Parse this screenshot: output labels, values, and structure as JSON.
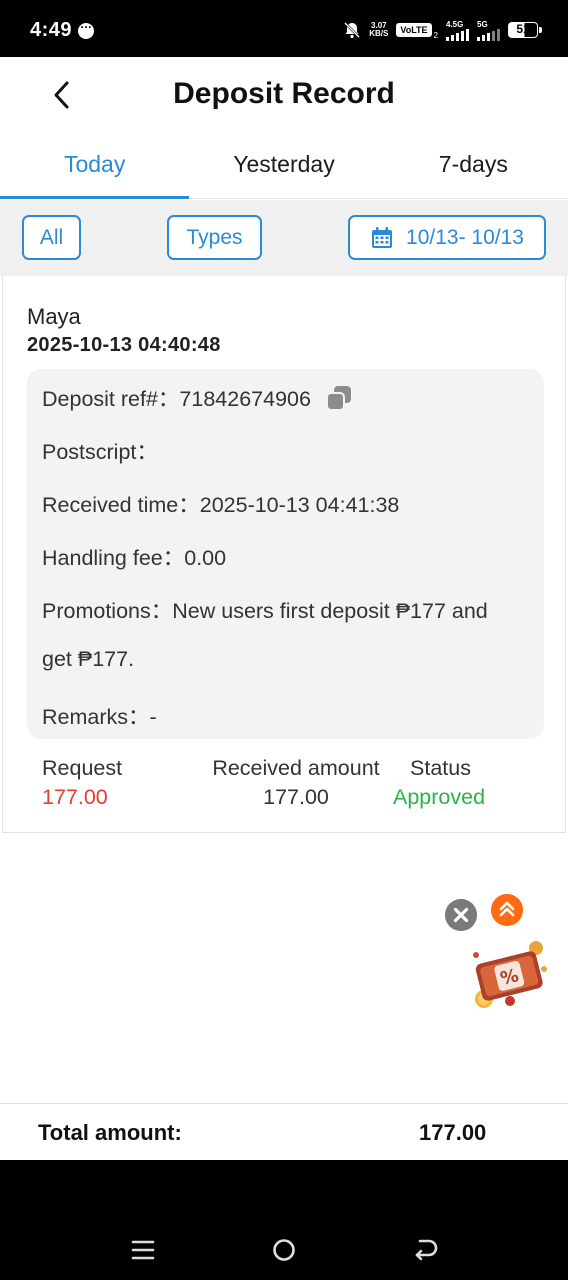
{
  "status_bar": {
    "time": "4:49",
    "net_speed_value": "3.07",
    "net_speed_unit": "KB/S",
    "volte": "VoLTE",
    "sim_slot": "2",
    "network_1": "4.5G",
    "network_2": "5G",
    "battery": "51"
  },
  "header": {
    "title": "Deposit Record",
    "back_icon": "chevron-left-icon"
  },
  "tabs": [
    {
      "label": "Today",
      "active": true
    },
    {
      "label": "Yesterday",
      "active": false
    },
    {
      "label": "7-days",
      "active": false
    }
  ],
  "filters": {
    "all_label": "All",
    "types_label": "Types",
    "date_range": "10/13- 10/13",
    "date_icon": "calendar-icon"
  },
  "record": {
    "method": "Maya",
    "datetime": "2025-10-13 04:40:48",
    "details": {
      "ref_label": "Deposit ref#：",
      "ref_value": "71842674906",
      "postscript_label": "Postscript：",
      "postscript_value": "",
      "received_label": "Received time：",
      "received_value": "2025-10-13 04:41:38",
      "fee_label": "Handling fee：",
      "fee_value": "0.00",
      "promo_label": "Promotions：",
      "promo_value_line1": "New users first deposit ₱177 and",
      "promo_value_line2": "get ₱177.",
      "remarks_label": "Remarks：",
      "remarks_value": "-"
    },
    "summary": {
      "request_label": "Request",
      "request_value": "177.00",
      "received_amount_label": "Received amount",
      "received_amount_value": "177.00",
      "status_label": "Status",
      "status_value": "Approved"
    }
  },
  "totals": {
    "label": "Total amount:",
    "value": "177.00"
  },
  "colors": {
    "accent": "#2a8ad6",
    "request_red": "#e2402b",
    "approved_green": "#2ab24a",
    "float_orange": "#ff6a13"
  }
}
